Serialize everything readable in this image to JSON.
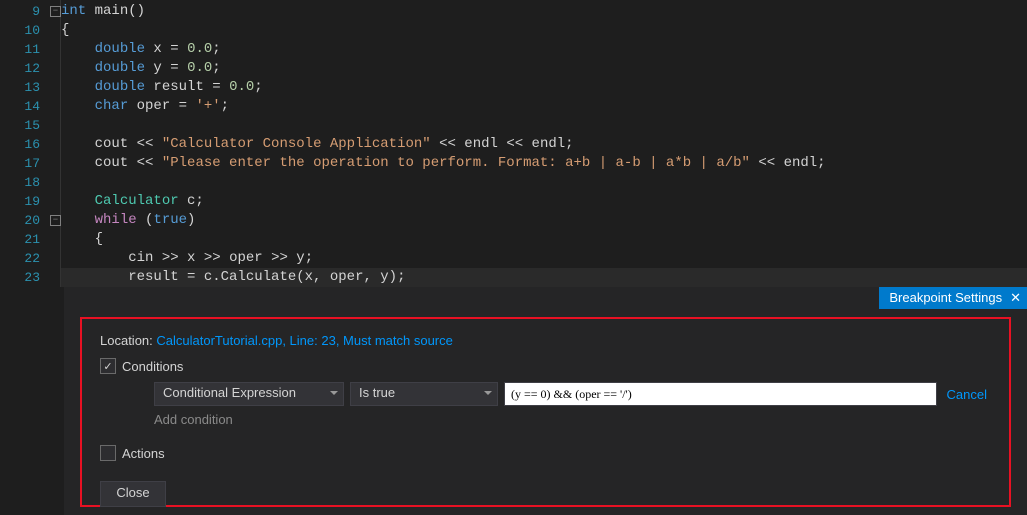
{
  "lines_start": 9,
  "code": [
    {
      "n": 9,
      "fold": "-",
      "segs": [
        [
          "k-blue",
          "int"
        ],
        [
          "",
          " main()"
        ]
      ]
    },
    {
      "n": 10,
      "segs": [
        [
          "",
          "{"
        ]
      ]
    },
    {
      "n": 11,
      "segs": [
        [
          "",
          "    "
        ],
        [
          "k-blue",
          "double"
        ],
        [
          "",
          " x "
        ],
        [
          "",
          "="
        ],
        [
          "",
          " "
        ],
        [
          "num",
          "0.0"
        ],
        [
          "",
          ";"
        ]
      ]
    },
    {
      "n": 12,
      "segs": [
        [
          "",
          "    "
        ],
        [
          "k-blue",
          "double"
        ],
        [
          "",
          " y "
        ],
        [
          "",
          "="
        ],
        [
          "",
          " "
        ],
        [
          "num",
          "0.0"
        ],
        [
          "",
          ";"
        ]
      ]
    },
    {
      "n": 13,
      "segs": [
        [
          "",
          "    "
        ],
        [
          "k-blue",
          "double"
        ],
        [
          "",
          " result "
        ],
        [
          "",
          "="
        ],
        [
          "",
          " "
        ],
        [
          "num",
          "0.0"
        ],
        [
          "",
          ";"
        ]
      ]
    },
    {
      "n": 14,
      "segs": [
        [
          "",
          "    "
        ],
        [
          "k-blue",
          "char"
        ],
        [
          "",
          " oper "
        ],
        [
          "",
          "="
        ],
        [
          "",
          " "
        ],
        [
          "str",
          "'+'"
        ],
        [
          "",
          ";"
        ]
      ]
    },
    {
      "n": 15,
      "segs": [
        [
          "",
          ""
        ]
      ]
    },
    {
      "n": 16,
      "segs": [
        [
          "",
          "    cout "
        ],
        [
          "",
          "<<"
        ],
        [
          "",
          " "
        ],
        [
          "str",
          "\"Calculator Console Application\""
        ],
        [
          "",
          " "
        ],
        [
          "",
          "<<"
        ],
        [
          "",
          " endl "
        ],
        [
          "",
          "<<"
        ],
        [
          "",
          " endl;"
        ]
      ]
    },
    {
      "n": 17,
      "segs": [
        [
          "",
          "    cout "
        ],
        [
          "",
          "<<"
        ],
        [
          "",
          " "
        ],
        [
          "str",
          "\"Please enter the operation to perform. Format: a+b | a-b | a*b | a/b\""
        ],
        [
          "",
          " "
        ],
        [
          "",
          "<<"
        ],
        [
          "",
          " endl;"
        ]
      ]
    },
    {
      "n": 18,
      "segs": [
        [
          "",
          ""
        ]
      ]
    },
    {
      "n": 19,
      "segs": [
        [
          "",
          "    "
        ],
        [
          "cls",
          "Calculator"
        ],
        [
          "",
          " c;"
        ]
      ]
    },
    {
      "n": 20,
      "fold": "-",
      "segs": [
        [
          "",
          "    "
        ],
        [
          "k-ctrl",
          "while"
        ],
        [
          "",
          " ("
        ],
        [
          "k-blue",
          "true"
        ],
        [
          "",
          ")"
        ]
      ]
    },
    {
      "n": 21,
      "segs": [
        [
          "",
          "    {"
        ]
      ],
      "guide": true
    },
    {
      "n": 22,
      "segs": [
        [
          "",
          "        cin "
        ],
        [
          "",
          ">>"
        ],
        [
          "",
          " x "
        ],
        [
          "",
          ">>"
        ],
        [
          "",
          " oper "
        ],
        [
          "",
          ">>"
        ],
        [
          "",
          " y;"
        ]
      ],
      "guide": true
    },
    {
      "n": 23,
      "segs": [
        [
          "",
          "        result "
        ],
        [
          "",
          "="
        ],
        [
          "",
          " c.Calculate(x, oper, y);"
        ]
      ],
      "guide": true,
      "brk": true
    }
  ],
  "panel": {
    "title": "Breakpoint Settings",
    "close_x": "✕",
    "location_label": "Location: ",
    "location_link": "CalculatorTutorial.cpp, Line: 23, Must match source",
    "conditions_label": "Conditions",
    "conditions_checked": true,
    "cond_type": "Conditional Expression",
    "cond_op": "Is true",
    "cond_expr": "(y == 0) && (oper == '/')",
    "cancel": "Cancel",
    "add_condition": "Add condition",
    "actions_label": "Actions",
    "actions_checked": false,
    "close": "Close"
  }
}
